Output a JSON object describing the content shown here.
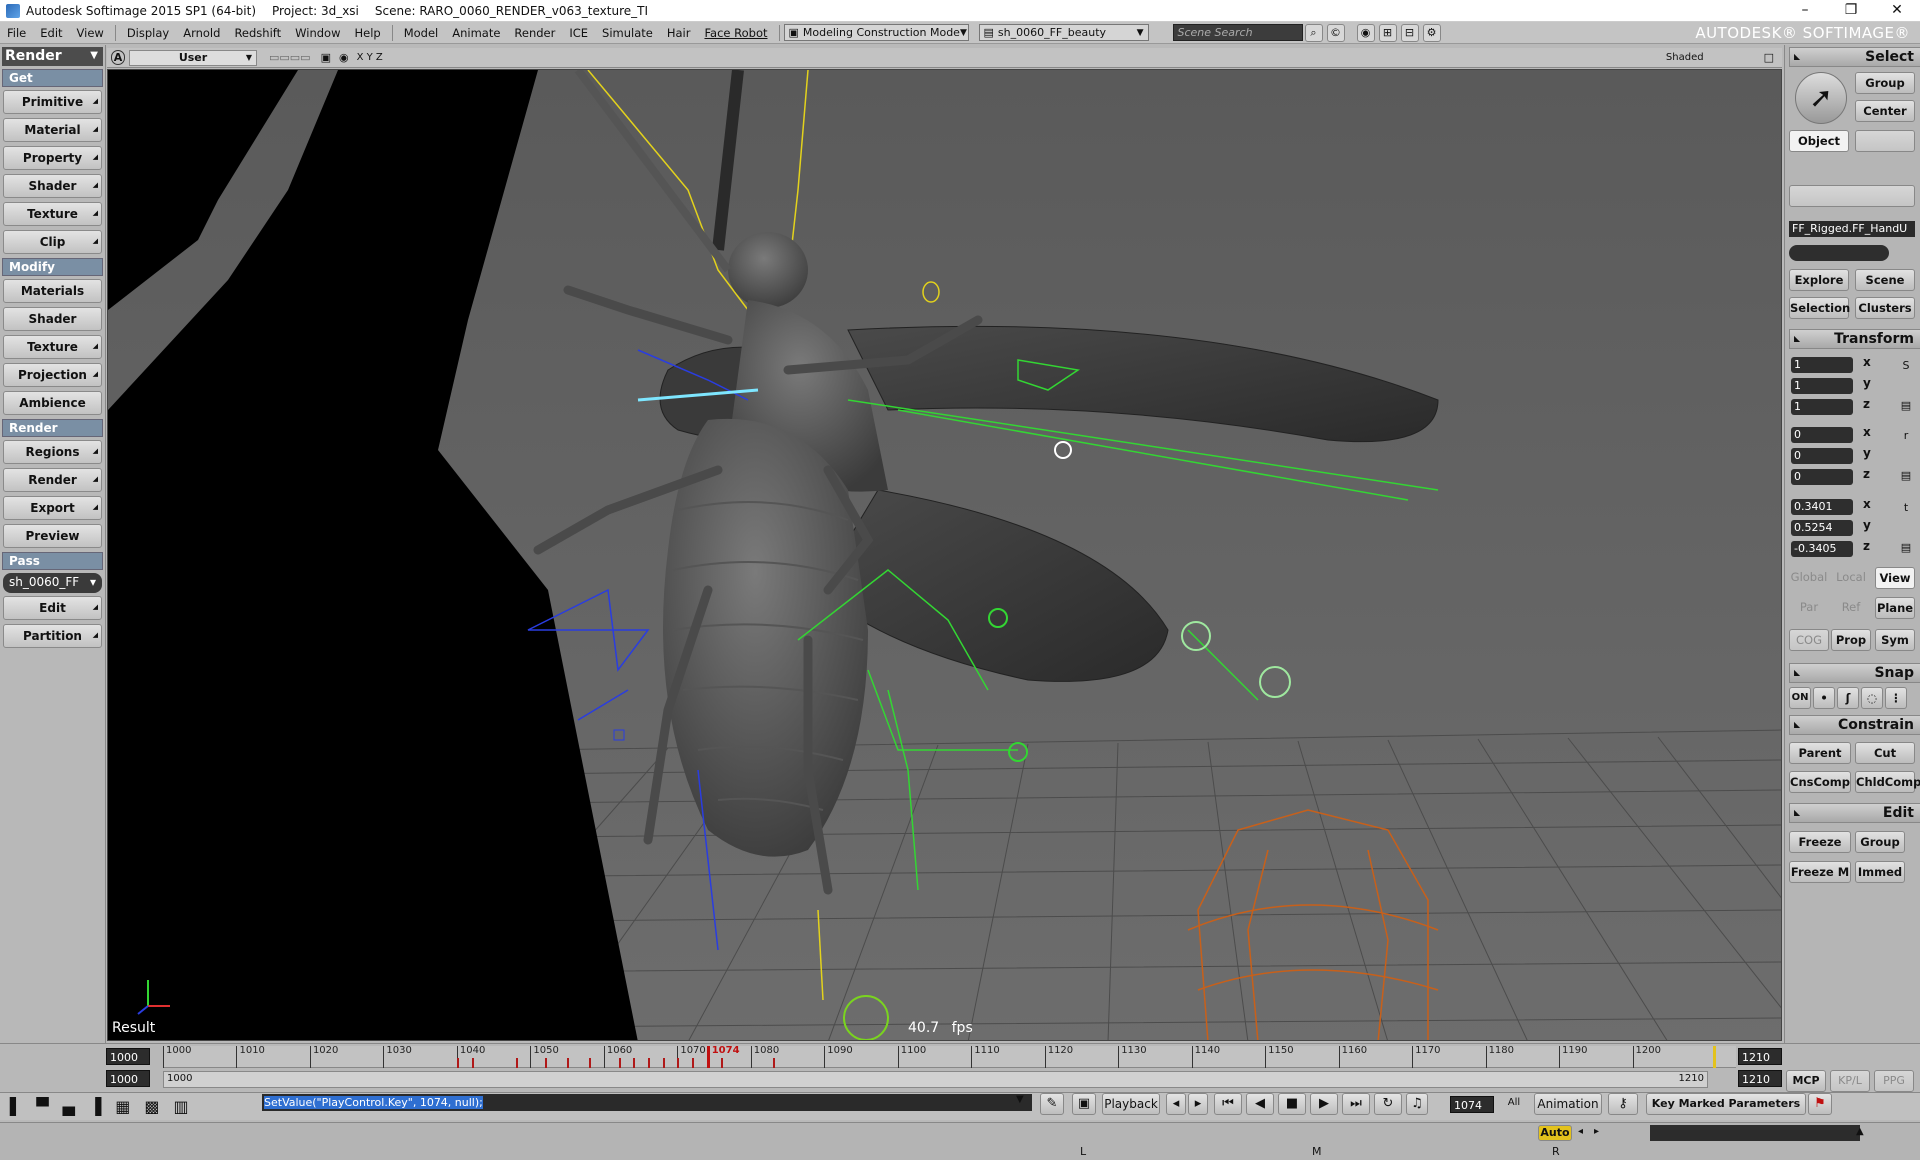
{
  "window": {
    "app_title": "Autodesk Softimage 2015 SP1 (64-bit)",
    "project": "Project: 3d_xsi",
    "scene": "Scene: RARO_0060_RENDER_v063_texture_TI"
  },
  "menubar": {
    "items": [
      "File",
      "Edit",
      "View",
      "Display",
      "Arnold",
      "Redshift",
      "Window",
      "Help",
      "Model",
      "Animate",
      "Render",
      "ICE",
      "Simulate",
      "Hair",
      "Face Robot"
    ],
    "mode_dropdown": "Modeling Construction Mode",
    "pass_dropdown": "sh_0060_FF_beauty",
    "search_placeholder": "Scene Search",
    "brand": "AUTODESK® SOFTIMAGE®"
  },
  "left_panel": {
    "module": "Render",
    "sections": [
      {
        "title": "Get",
        "buttons": [
          "Primitive",
          "Material",
          "Property",
          "Shader",
          "Texture",
          "Clip"
        ]
      },
      {
        "title": "Modify",
        "buttons": [
          "Materials",
          "Shader",
          "Texture",
          "Projection",
          "Ambience"
        ]
      },
      {
        "title": "Render",
        "buttons": [
          "Regions",
          "Render",
          "Export",
          "Preview"
        ]
      },
      {
        "title": "Pass",
        "pass_value": "sh_0060_FF",
        "buttons": [
          "Edit",
          "Partition"
        ]
      }
    ]
  },
  "viewport": {
    "camera": "User",
    "axes_label": "X Y Z",
    "display_mode": "Shaded",
    "result_label": "Result",
    "fps": "40.7",
    "fps_unit": "fps"
  },
  "right_panel": {
    "select_title": "Select",
    "group_btn": "Group",
    "center_btn": "Center",
    "object_btn": "Object",
    "selected_object": "FF_Rigged.FF_HandU",
    "explore_btn": "Explore",
    "scene_btn": "Scene",
    "selection_btn": "Selection",
    "clusters_btn": "Clusters",
    "transform_title": "Transform",
    "scale": [
      "1",
      "1",
      "1"
    ],
    "rotate": [
      "0",
      "0",
      "0"
    ],
    "translate": [
      "0.3401",
      "0.5254",
      "-0.3405"
    ],
    "axis_labels": [
      "x",
      "y",
      "z"
    ],
    "global_btn": "Global",
    "local_btn": "Local",
    "view_btn": "View",
    "par_btn": "Par",
    "ref_btn": "Ref",
    "plane_btn": "Plane",
    "cog_btn": "COG",
    "prop_btn": "Prop",
    "sym_btn": "Sym",
    "snap_title": "Snap",
    "snap_on": "ON",
    "constrain_title": "Constrain",
    "parent_btn": "Parent",
    "cut_btn": "Cut",
    "cnscomp_btn": "CnsComp",
    "chldcomp_btn": "ChldComp",
    "edit_title": "Edit",
    "freeze_btn": "Freeze",
    "group2_btn": "Group",
    "freezem_btn": "Freeze M",
    "immed_btn": "Immed",
    "tabs": [
      "MCP",
      "KP/L",
      "PPG"
    ]
  },
  "timeline": {
    "start_top": "1000",
    "start_bottom": "1000",
    "range_start": "1000",
    "end_top": "1210",
    "end_bottom": "1210",
    "range_end": "1210",
    "ticks": [
      "1000",
      "1010",
      "1020",
      "1030",
      "1040",
      "1050",
      "1060",
      "1070",
      "1080",
      "1090",
      "1100",
      "1110",
      "1120",
      "1130",
      "1140",
      "1150",
      "1160",
      "1170",
      "1180",
      "1190",
      "1200"
    ],
    "current_frame": "1074",
    "key_frames": [
      1040,
      1042,
      1048,
      1052,
      1055,
      1058,
      1062,
      1064,
      1066,
      1068,
      1070,
      1072,
      1074,
      1076,
      1083
    ]
  },
  "cmdbar": {
    "command": "SetValue(\"PlayControl.Key\", 1074, null);",
    "playback_label": "Playback",
    "frame_value": "1074",
    "all_label": "All",
    "animation_label": "Animation",
    "auto_label": "Auto",
    "key_marked": "Key Marked Parameters"
  },
  "status": {
    "mouse_labels": [
      "L",
      "M",
      "R"
    ]
  },
  "colors": {
    "viewport_bg": "#5e5e5e",
    "rig_green": "#33d633",
    "rig_yellow": "#e3d21c",
    "rig_blue": "#2a3de0",
    "rig_orange": "#c8601a",
    "selection_blue": "#2f6fd1"
  }
}
